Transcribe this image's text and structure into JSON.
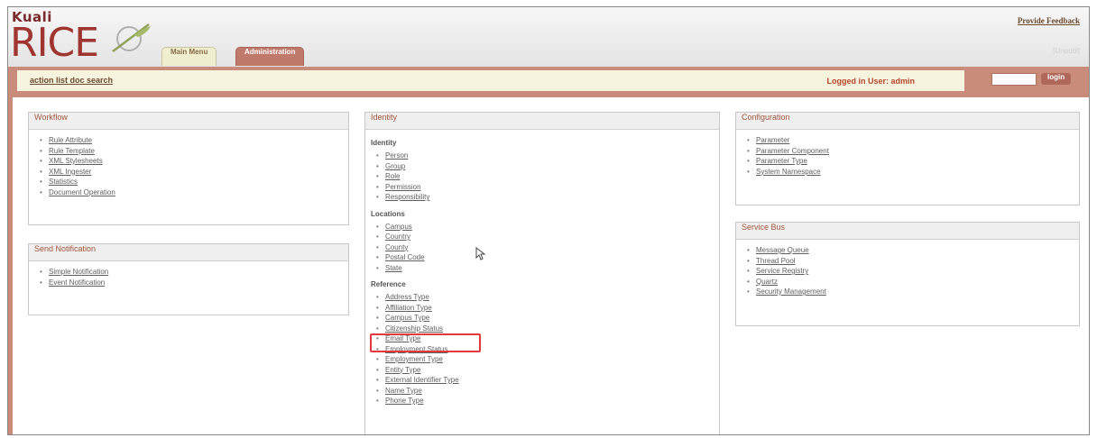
{
  "header": {
    "logo_top": "Kuali",
    "logo_main": "RICE",
    "feedback_link": "Provide Feedback",
    "faded_label": "[Unpubl]",
    "tabs": [
      {
        "label": "Main Menu"
      },
      {
        "label": "Administration"
      }
    ]
  },
  "utility": {
    "links": "action list doc search",
    "logged_in": "Logged in User: admin",
    "login_button": "login"
  },
  "panels": {
    "workflow": {
      "title": "Workflow",
      "items": [
        "Rule Attribute",
        "Rule Template",
        "XML Stylesheets",
        "XML Ingester",
        "Statistics",
        "Document Operation"
      ]
    },
    "send_notification": {
      "title": "Send Notification",
      "items": [
        "Simple Notification",
        "Event Notification"
      ]
    },
    "identity": {
      "title": "Identity",
      "sections": [
        {
          "heading": "Identity",
          "items": [
            "Person",
            "Group",
            "Role",
            "Permission",
            "Responsibility"
          ]
        },
        {
          "heading": "Locations",
          "items": [
            "Campus",
            "Country",
            "County",
            "Postal Code",
            "State"
          ]
        },
        {
          "heading": "Reference",
          "items": [
            "Address Type",
            "Affiliation Type",
            "Campus Type",
            "Citizenship Status",
            "Email Type",
            "Employment Status",
            "Employment Type",
            "Entity Type",
            "External Identifier Type",
            "Name Type",
            "Phone Type"
          ]
        }
      ]
    },
    "configuration": {
      "title": "Configuration",
      "items": [
        "Parameter",
        "Parameter Component",
        "Parameter Type",
        "System Namespace"
      ]
    },
    "service_bus": {
      "title": "Service Bus",
      "items": [
        "Message Queue",
        "Thread Pool",
        "Service Registry",
        "Quartz",
        "Security Management"
      ]
    }
  },
  "colors": {
    "accent": "#c98b7a",
    "brand": "#9f3530",
    "highlight": "#e03a3a"
  }
}
